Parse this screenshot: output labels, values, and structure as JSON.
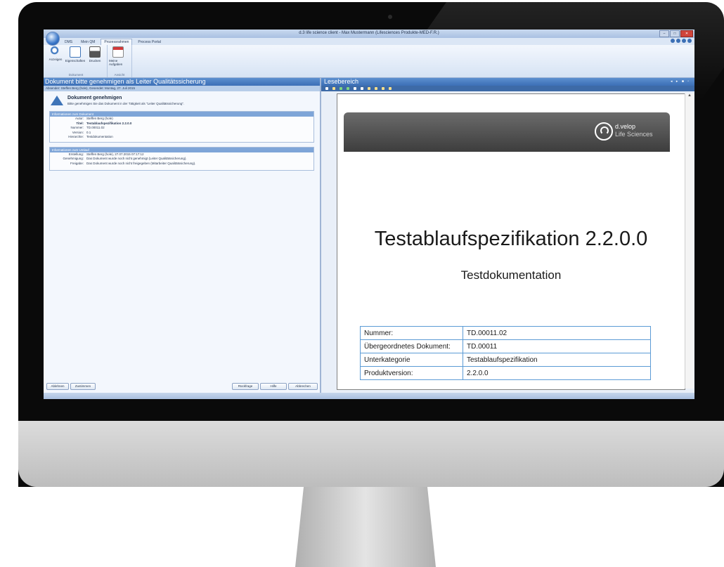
{
  "window": {
    "title": "d.3 life science client - Max Mustermann (Lifesciences Produkte-MED-F.R.)"
  },
  "tabs": [
    "DMS",
    "Mein QM",
    "Prozessrahmen",
    "Process Portal"
  ],
  "ribbon": {
    "group_dokument": {
      "label": "Dokument",
      "buttons": [
        "Anzeigen",
        "Eigenschaften",
        "Drucken"
      ]
    },
    "group_ansicht": {
      "label": "Ansicht",
      "buttons": [
        "Meine Aufgaben"
      ]
    }
  },
  "left_pane": {
    "header": "Dokument bitte genehmigen als Leiter Qualitätssicherung",
    "sender_line": "Absender: Steffen Berg (hole), Gesendet: Montag, 27. Juli 2015",
    "approve_title": "Dokument genehmigen",
    "approve_text": "Bitte genehmigen Sie das Dokument in der Tätigkeit als \"Leiter Qualitätssicherung\".",
    "doc_info": {
      "head": "Informationen zum Dokument",
      "rows": [
        {
          "k": "Autor:",
          "v": "Steffen Berg (hole)"
        },
        {
          "k": "Titel:",
          "v": "Testablaufspezifikation 2.2.0.0"
        },
        {
          "k": "Nummer:",
          "v": "TD.00011.02"
        },
        {
          "k": "Version:",
          "v": "0.1"
        },
        {
          "k": "Hierarchie:",
          "v": "Testdokumentation"
        }
      ]
    },
    "flow_info": {
      "head": "Informationen zum Umlauf",
      "rows": [
        {
          "k": "Erstellung:",
          "v": "Steffen Berg (hole), 27.07.2015 07:17:12"
        },
        {
          "k": "",
          "v": ""
        },
        {
          "k": "Genehmigung:",
          "v": "Das Dokument wurde noch nicht genehmigt (Leiter Qualitätssicherung)."
        },
        {
          "k": "Freigabe:",
          "v": "Das Dokument wurde noch nicht freigegeben (Mitarbeiter Qualitätssicherung)."
        }
      ]
    },
    "buttons": {
      "reject": "Ablehnen",
      "approve": "Zustimmen",
      "query": "Rückfrage",
      "help": "Hilfe",
      "cancel": "Abbrechen"
    }
  },
  "right_pane": {
    "header": "Lesebereich",
    "logo_name": "d.velop",
    "logo_sub": "Life Sciences",
    "doc_title": "Testablaufspezifikation 2.2.0.0",
    "doc_subtitle": "Testdokumentation",
    "meta_table": [
      [
        "Nummer:",
        "TD.00011.02"
      ],
      [
        "Übergeordnetes Dokument:",
        "TD.00011"
      ],
      [
        "Unterkategorie",
        "Testablaufspezifikation"
      ],
      [
        "Produktversion:",
        "2.2.0.0"
      ]
    ]
  },
  "colors": {
    "header_blue": "#3c6fb6",
    "table_border": "#5b9bd5",
    "banner_gray": "#4a4a4a"
  }
}
